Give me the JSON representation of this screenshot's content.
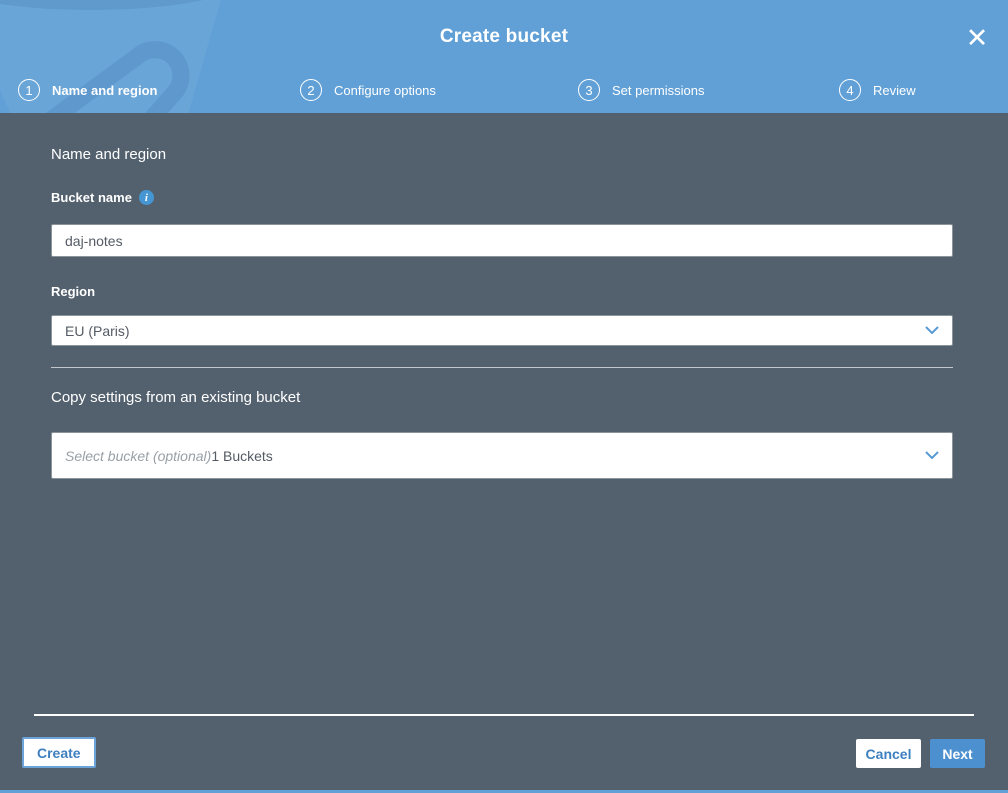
{
  "dialog": {
    "title": "Create bucket",
    "close_glyph": "✕"
  },
  "steps": [
    {
      "number": "1",
      "label": "Name and region"
    },
    {
      "number": "2",
      "label": "Configure options"
    },
    {
      "number": "3",
      "label": "Set permissions"
    },
    {
      "number": "4",
      "label": "Review"
    }
  ],
  "form": {
    "section_heading": "Name and region",
    "bucket_name": {
      "label": "Bucket name",
      "info_glyph": "i",
      "value": "daj-notes"
    },
    "region": {
      "label": "Region",
      "selected": "EU (Paris)"
    },
    "copy_settings": {
      "heading": "Copy settings from an existing bucket",
      "placeholder": "Select bucket (optional)",
      "bucket_count": "1 Buckets"
    }
  },
  "footer": {
    "create_label": "Create",
    "cancel_label": "Cancel",
    "next_label": "Next"
  },
  "colors": {
    "header_blue": "#61a0d6",
    "body_slate": "#53616e",
    "accent_blue": "#4d90cf",
    "button_text_blue": "#3e7fbf",
    "field_text": "#545b64"
  }
}
